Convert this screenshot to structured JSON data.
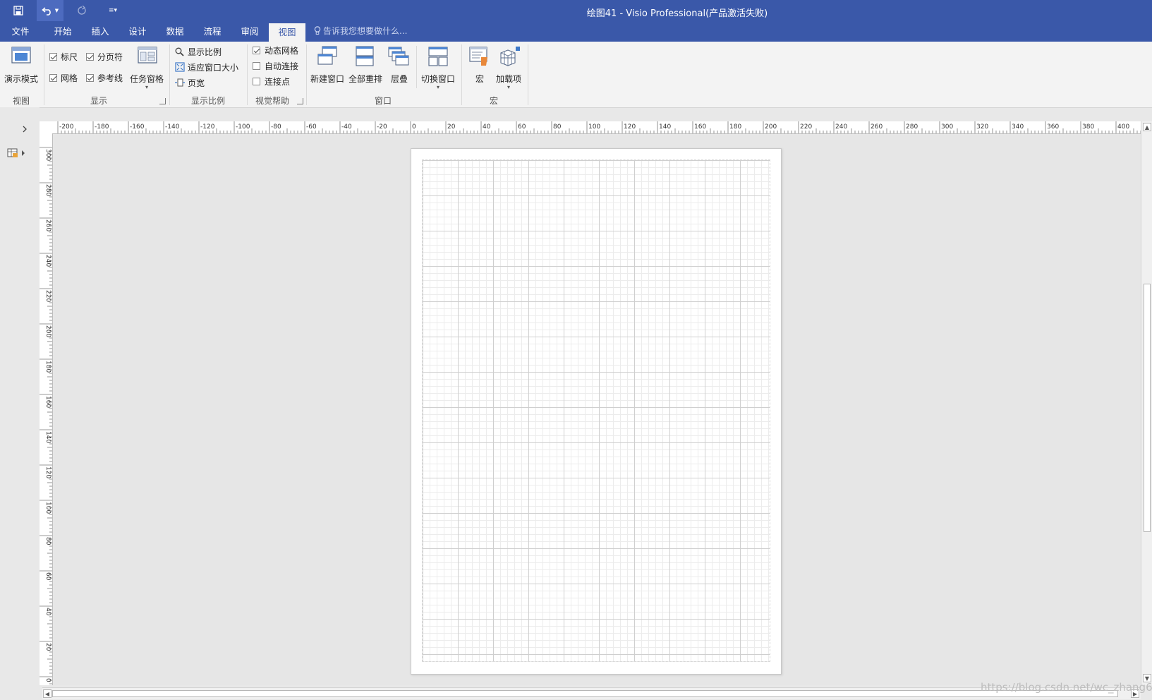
{
  "window": {
    "title": "绘图41 - Visio Professional(产品激活失败)"
  },
  "quick_access": {
    "save_icon": "save-icon",
    "undo_icon": "undo-icon",
    "redo_icon": "redo-icon",
    "customize_icon": "customize-dropdown-icon"
  },
  "tabs": [
    {
      "label": "文件"
    },
    {
      "label": "开始"
    },
    {
      "label": "插入"
    },
    {
      "label": "设计"
    },
    {
      "label": "数据"
    },
    {
      "label": "流程"
    },
    {
      "label": "审阅"
    },
    {
      "label": "视图"
    }
  ],
  "active_tab": "视图",
  "tell_me": {
    "placeholder": "告诉我您想要做什么..."
  },
  "ribbon": {
    "view_group": {
      "label": "视图",
      "presentation_mode": "演示模式"
    },
    "show_group": {
      "label": "显示",
      "ruler": "标尺",
      "ruler_checked": true,
      "page_breaks": "分页符",
      "page_breaks_checked": true,
      "grid": "网格",
      "grid_checked": true,
      "guides": "参考线",
      "guides_checked": true,
      "task_panes": "任务窗格"
    },
    "zoom_group": {
      "label": "显示比例",
      "zoom": "显示比例",
      "fit_to_window": "适应窗口大小",
      "page_width": "页宽"
    },
    "visual_aids_group": {
      "label": "视觉帮助",
      "dynamic_grid": "动态网格",
      "dynamic_grid_checked": true,
      "auto_connect": "自动连接",
      "auto_connect_checked": false,
      "connection_points": "连接点",
      "connection_points_checked": false
    },
    "window_group": {
      "label": "窗口",
      "new_window": "新建窗口",
      "arrange_all": "全部重排",
      "cascade": "层叠",
      "switch_windows": "切换窗口"
    },
    "macros_group": {
      "label": "宏",
      "macros": "宏",
      "add_ins": "加载项"
    }
  },
  "rulers": {
    "horizontal_labels": [
      "-200",
      "-180",
      "-160",
      "-140",
      "-120",
      "-100",
      "-80",
      "-60",
      "-40",
      "-20",
      "0",
      "20",
      "40",
      "60",
      "80",
      "100",
      "120",
      "140",
      "160",
      "180",
      "200",
      "220",
      "240",
      "260",
      "280",
      "300",
      "320",
      "340",
      "360",
      "380",
      "400"
    ],
    "vertical_labels": [
      "300",
      "280",
      "260",
      "240",
      "220",
      "200",
      "180",
      "160",
      "140",
      "120",
      "100",
      "80",
      "60",
      "40",
      "20",
      "0"
    ]
  },
  "left_pane": {
    "expand_icon": "chevron-right-icon",
    "shapes_icon": "shapes-pane-icon"
  },
  "watermark": "https://blog.csdn.net/wc_zhang66"
}
